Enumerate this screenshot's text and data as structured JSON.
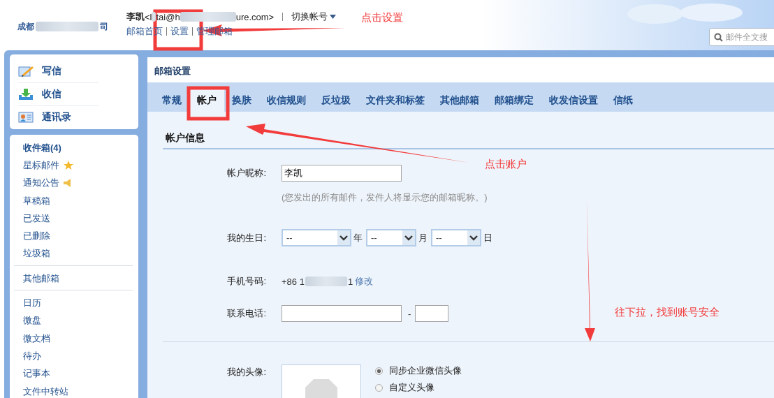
{
  "header": {
    "company_parts": [
      "成都",
      "司"
    ],
    "user_name": "李凯",
    "email_parts": [
      "<l",
      "tai@h",
      "ure.com>"
    ],
    "switch_account": "切换帐号",
    "links": [
      {
        "label": "邮箱首页"
      },
      {
        "label": "设置"
      },
      {
        "label": "管理邮箱"
      }
    ],
    "search": {
      "placeholder": "邮件全文搜"
    }
  },
  "sidebar": {
    "actions": [
      {
        "label": "写信",
        "kind": "compose"
      },
      {
        "label": "收信",
        "kind": "receive"
      },
      {
        "label": "通讯录",
        "kind": "contacts"
      }
    ],
    "folder_groups": [
      [
        {
          "label": "收件箱(4)",
          "bold": true
        },
        {
          "label": "星标邮件",
          "bold": false,
          "kind": "star"
        },
        {
          "label": "通知公告",
          "bold": false,
          "kind": "speaker"
        },
        {
          "label": "草稿箱",
          "bold": false
        },
        {
          "label": "已发送",
          "bold": false
        },
        {
          "label": "已删除",
          "bold": false
        },
        {
          "label": "垃圾箱",
          "bold": false
        }
      ],
      [
        {
          "label": "其他邮箱",
          "bold": false
        }
      ],
      [
        {
          "label": "日历",
          "bold": false
        },
        {
          "label": "微盘",
          "bold": false
        },
        {
          "label": "微文档",
          "bold": false
        },
        {
          "label": "待办",
          "bold": false
        },
        {
          "label": "记事本",
          "bold": false
        },
        {
          "label": "文件中转站",
          "bold": false
        }
      ]
    ]
  },
  "settings": {
    "title": "邮箱设置",
    "tabs": [
      {
        "label": "常规",
        "selected": false
      },
      {
        "label": "帐户",
        "selected": true
      },
      {
        "label": "换肤",
        "selected": false
      },
      {
        "label": "收信规则",
        "selected": false
      },
      {
        "label": "反垃圾",
        "selected": false
      },
      {
        "label": "文件夹和标签",
        "selected": false
      },
      {
        "label": "其他邮箱",
        "selected": false
      },
      {
        "label": "邮箱绑定",
        "selected": false
      },
      {
        "label": "收发信设置",
        "selected": false
      },
      {
        "label": "信纸",
        "selected": false
      }
    ],
    "section_title": "帐户信息",
    "rows": [
      {
        "kind": "text",
        "label": "帐户昵称:",
        "value": "李凯",
        "hint": "(您发出的所有邮件，发件人将显示您的邮箱昵称。)"
      },
      {
        "kind": "date",
        "label": "我的生日:",
        "selects": [
          {
            "value": "--",
            "unit": "年"
          },
          {
            "value": "--",
            "unit": "月"
          },
          {
            "value": "--",
            "unit": "日"
          }
        ]
      },
      {
        "kind": "phone",
        "label": "手机号码:",
        "number_parts": [
          "+86 1",
          "1"
        ],
        "link": "修改"
      },
      {
        "kind": "contact",
        "label": "联系电话:",
        "separator": "-"
      },
      {
        "kind": "divider"
      },
      {
        "kind": "avatar",
        "label": "我的头像:",
        "options": [
          {
            "label": "同步企业微信头像",
            "selected": true
          },
          {
            "label": "自定义头像",
            "selected": false
          }
        ]
      }
    ]
  },
  "annotations": [
    {
      "text": "点击设置"
    },
    {
      "text": "点击账户"
    },
    {
      "text": "往下拉，找到账号安全"
    }
  ]
}
